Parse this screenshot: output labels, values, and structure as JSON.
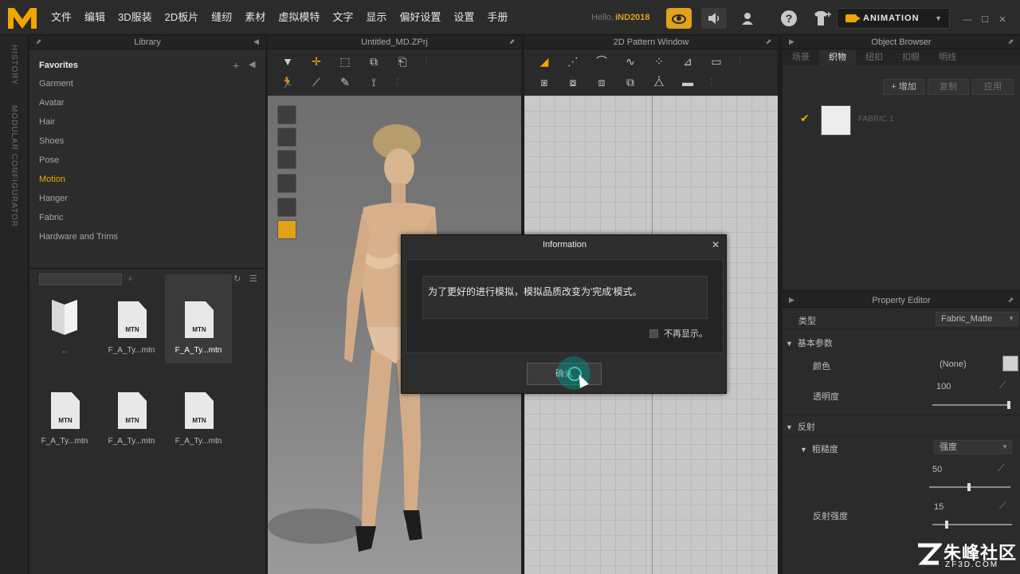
{
  "menubar": {
    "items": [
      "文件",
      "编辑",
      "3D服装",
      "2D板片",
      "缝纫",
      "素材",
      "虚拟模特",
      "文字",
      "显示",
      "偏好设置",
      "设置",
      "手册"
    ],
    "hello_label": "Hello,",
    "user_name": "iND2018",
    "animation_label": "ANIMATION"
  },
  "vertical_strip": {
    "history": "HISTORY",
    "modular": "MODULAR CONFIGURATOR"
  },
  "library": {
    "title": "Library",
    "favorites": "Favorites",
    "items": [
      "Garment",
      "Avatar",
      "Hair",
      "Shoes",
      "Pose",
      "Motion",
      "Hanger",
      "Fabric",
      "Hardware and Trims"
    ],
    "active_item": "Motion",
    "files": [
      {
        "name": "..",
        "type": "folder"
      },
      {
        "name": "F_A_Ty...mtn",
        "type": "MTN"
      },
      {
        "name": "F_A_Ty...mtn",
        "type": "MTN",
        "selected": true
      },
      {
        "name": "F_A_Ty...mtn",
        "type": "MTN"
      },
      {
        "name": "F_A_Ty...mtn",
        "type": "MTN"
      },
      {
        "name": "F_A_Ty...mtn",
        "type": "MTN"
      }
    ]
  },
  "view3d": {
    "title": "Untitled_MD.ZPrj"
  },
  "view2d": {
    "title": "2D Pattern Window"
  },
  "object_browser": {
    "title": "Object Browser",
    "tabs": [
      "场景",
      "织物",
      "纽扣",
      "扣眼",
      "明线"
    ],
    "active_tab": "织物",
    "buttons": {
      "add": "+ 增加",
      "copy": "复制",
      "apply": "应用"
    },
    "fabric_name": "FABRIC 1"
  },
  "property_editor": {
    "title": "Property Editor",
    "type_label": "类型",
    "type_value": "Fabric_Matte",
    "basic_params": "基本参数",
    "color_label": "颜色",
    "color_value": "(None)",
    "opacity_label": "透明度",
    "opacity_value": "100",
    "reflection": "反射",
    "roughness_label": "粗糙度",
    "roughness_mode": "强度",
    "roughness_value": "50",
    "reflect_intensity_label": "反射强度",
    "reflect_intensity_value": "15"
  },
  "dialog": {
    "title": "Information",
    "message": "为了更好的进行模拟，模拟品质改变为'完成'模式。",
    "checkbox_label": "不再显示。",
    "ok_label": "确认"
  },
  "watermark": {
    "text": "朱峰社区",
    "sub": "ZF3D.COM"
  },
  "colors": {
    "accent": "#f0a500",
    "panel": "#2b2b2b",
    "grid": "#c8c8c8"
  }
}
